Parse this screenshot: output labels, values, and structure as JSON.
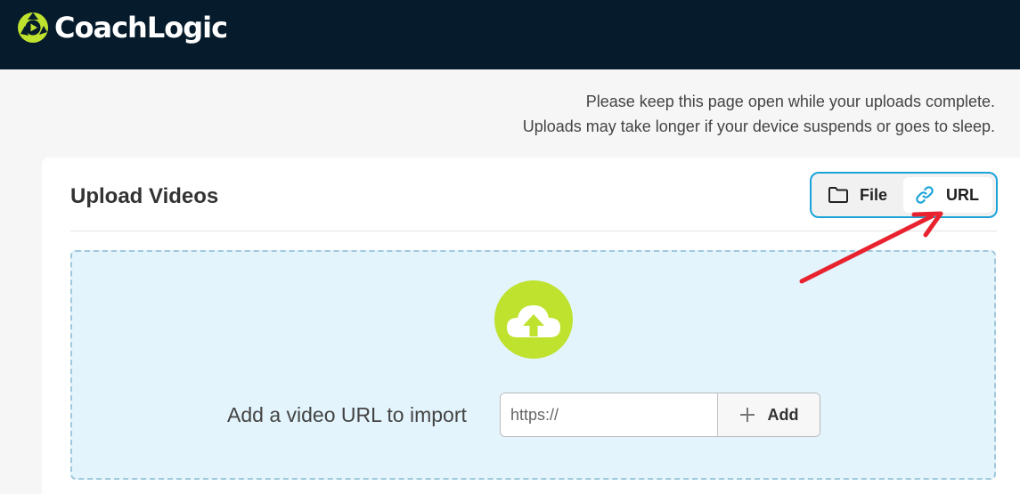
{
  "header": {
    "brand": "CoachLogic",
    "background_color": "#061b2b",
    "logo_color": "#bfe22f"
  },
  "notice": {
    "line1": "Please keep this page open while your uploads complete.",
    "line2": "Uploads may take longer if your device suspends or goes to sleep."
  },
  "upload_card": {
    "title": "Upload Videos",
    "source_toggle": {
      "file_label": "File",
      "url_label": "URL",
      "selected": "URL"
    },
    "dropzone": {
      "import_label": "Add a video URL to import",
      "url_input": {
        "value": "",
        "placeholder": "https://"
      },
      "add_button_label": "Add"
    }
  },
  "colors": {
    "accent": "#1ba3d9",
    "upload_circle": "#bfe22f",
    "dropzone_bg": "#e3f4fc",
    "annotation_arrow": "#e8232f"
  }
}
